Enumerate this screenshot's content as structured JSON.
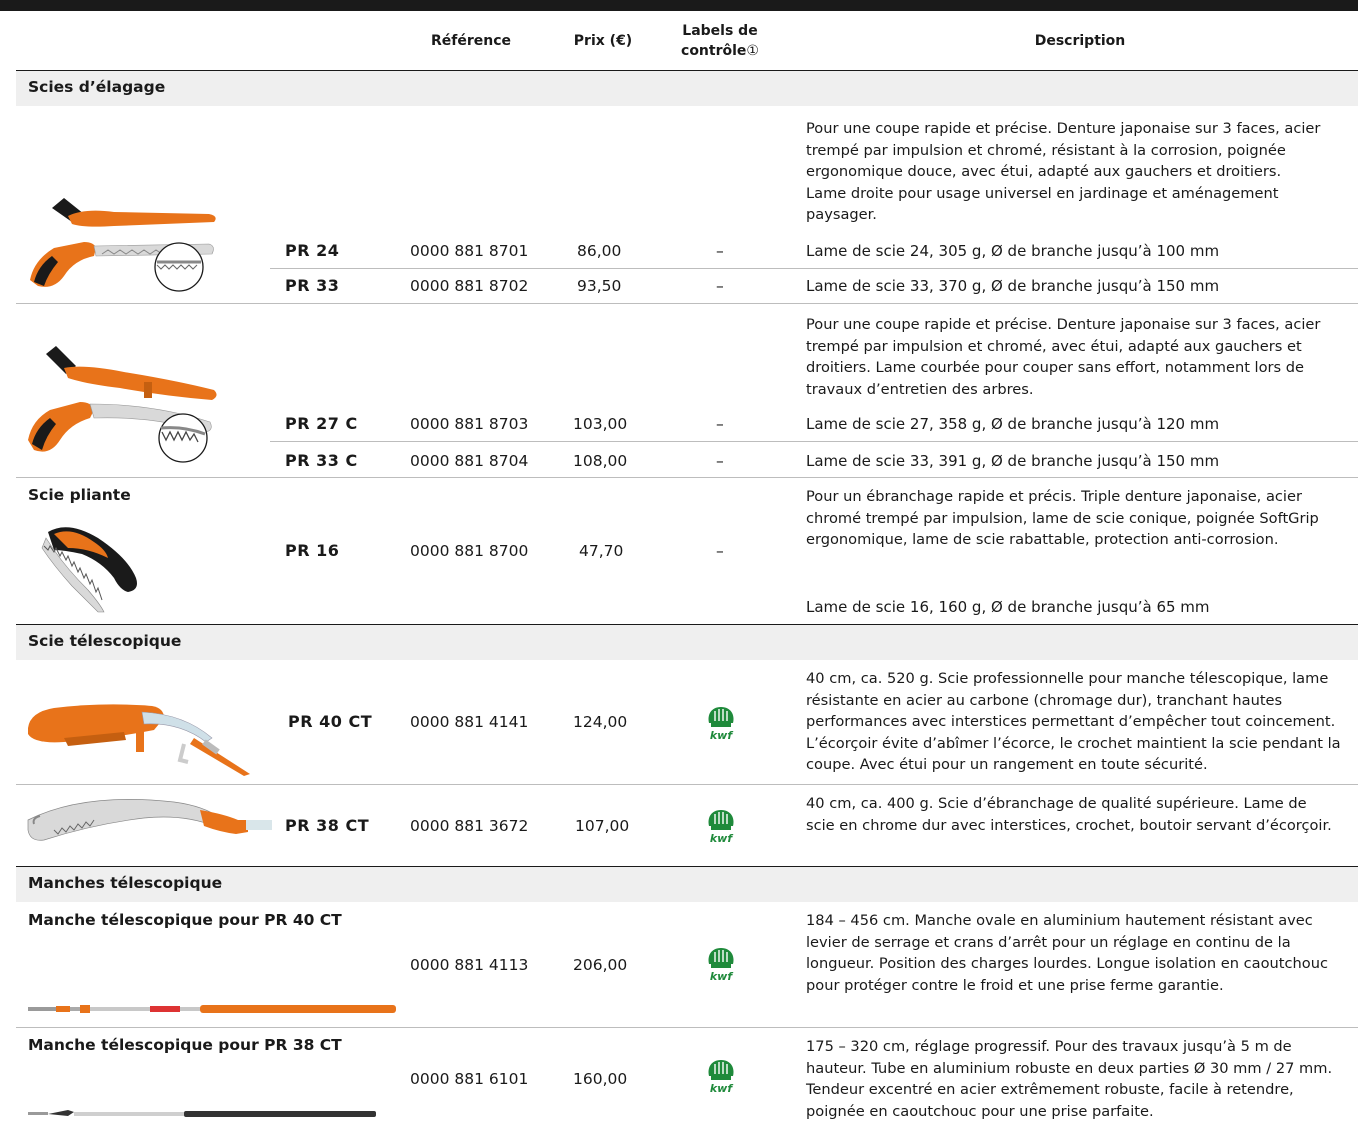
{
  "header": {
    "reference": "Référence",
    "price": "Prix (€)",
    "labels_line1": "Labels de",
    "labels_line2": "contrôle",
    "labels_note": "①",
    "description": "Description"
  },
  "sections": {
    "elagage": "Scies d’élagage",
    "pliante": "Scie pliante",
    "telescopique": "Scie télescopique",
    "manches": "Manches télescopique"
  },
  "group1": {
    "desc": "Pour une coupe rapide et précise. Denture japonaise sur 3 faces, acier trempé par impulsion et chromé, résistant à la corrosion, poignée ergonomique douce, avec étui, adapté aux gauchers et droitiers. Lame droite pour usage universel en jardinage et aménagement paysager.",
    "rows": [
      {
        "model": "PR 24",
        "ref": "0000 881 8701",
        "price": "86,00",
        "label": "–",
        "spec": "Lame de scie 24, 305 g, Ø de branche jusqu’à 100 mm"
      },
      {
        "model": "PR 33",
        "ref": "0000 881 8702",
        "price": "93,50",
        "label": "–",
        "spec": "Lame de scie 33, 370 g, Ø de branche jusqu’à 150 mm"
      }
    ]
  },
  "group2": {
    "desc": "Pour une coupe rapide et précise. Denture japonaise sur 3 faces, acier trempé par impulsion et chromé, avec étui, adapté aux gauchers et droitiers. Lame courbée pour couper sans effort, notamment lors de travaux d’entretien des arbres.",
    "rows": [
      {
        "model": "PR 27 C",
        "ref": "0000 881 8703",
        "price": "103,00",
        "label": "–",
        "spec": "Lame de scie 27, 358 g, Ø de branche jusqu’à 120 mm"
      },
      {
        "model": "PR 33 C",
        "ref": "0000 881 8704",
        "price": "108,00",
        "label": "–",
        "spec": "Lame de scie 33, 391 g, Ø de branche jusqu’à 150 mm"
      }
    ]
  },
  "group3": {
    "desc": "Pour un ébranchage rapide et précis. Triple denture japonaise, acier chromé trempé par impulsion, lame de scie conique, poignée SoftGrip ergonomique, lame de scie rabattable, protection anti-corrosion.",
    "model": "PR 16",
    "ref": "0000 881 8700",
    "price": "47,70",
    "label": "–",
    "spec": "Lame de scie 16, 160 g, Ø de branche jusqu’à 65 mm"
  },
  "group4": {
    "pr40": {
      "model": "PR 40 CT",
      "ref": "0000 881 4141",
      "price": "124,00",
      "desc": "40 cm, ca. 520 g. Scie professionnelle pour manche télescopique, lame résistante en acier au carbone (chromage dur), tranchant hautes performances avec interstices permettant d’empêcher tout coincement. L’écorçoir évite d’abîmer l’écorce, le crochet maintient la scie pendant la coupe. Avec étui pour un rangement en toute sécurité."
    },
    "pr38": {
      "model": "PR 38 CT",
      "ref": "0000 881 3672",
      "price": "107,00",
      "desc": "40 cm, ca. 400 g. Scie d’ébranchage de qualité supérieure. Lame de scie en chrome dur avec interstices, crochet, boutoir servant d’écorçoir."
    }
  },
  "group5": {
    "m40": {
      "title": "Manche télescopique pour PR 40 CT",
      "ref": "0000 881 4113",
      "price": "206,00",
      "desc": "184 – 456 cm. Manche ovale en aluminium hautement résistant avec levier de serrage et crans d’arrêt pour un réglage en continu de la longueur. Position des charges lourdes. Longue isolation en caoutchouc pour protéger contre le froid et une prise ferme garantie."
    },
    "m38": {
      "title": "Manche télescopique pour PR 38 CT",
      "ref": "0000 881 6101",
      "price": "160,00",
      "desc": "175 – 320 cm, réglage progressif. Pour des travaux jusqu’à 5 m de hauteur. Tube en aluminium robuste en deux parties Ø 30 mm / 27 mm. Tendeur excentré en acier extrêmement robuste, facile à retendre, poignée en caoutchouc pour une prise parfaite."
    }
  },
  "kwf_label": "kwf",
  "colors": {
    "orange": "#e8731a",
    "dark": "#1a1a1a",
    "band": "#efefef",
    "green": "#1f8a3b"
  }
}
